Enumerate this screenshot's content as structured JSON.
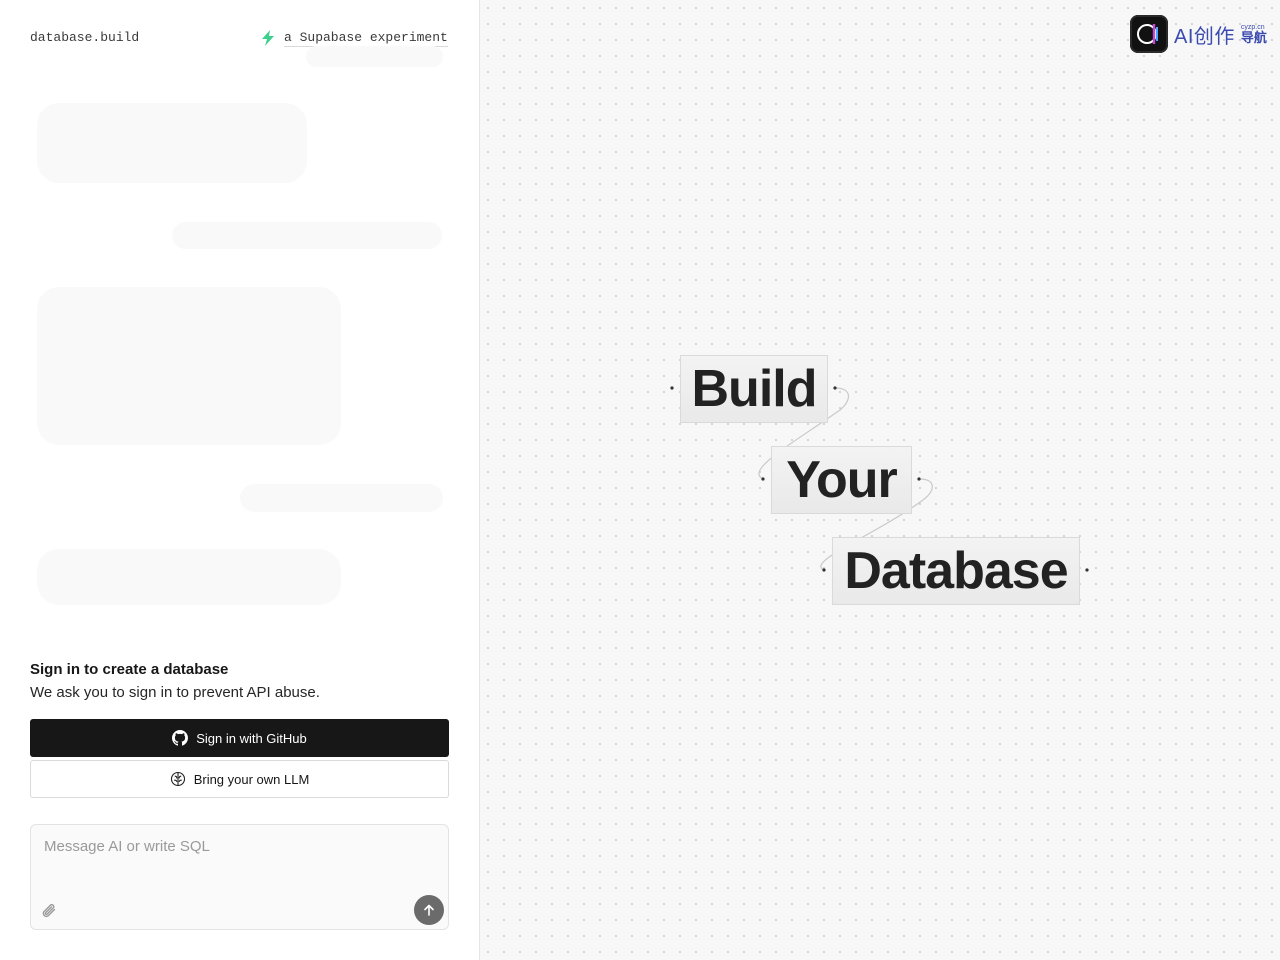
{
  "header": {
    "brand": "database.build",
    "experiment_text": "a Supabase experiment"
  },
  "signin": {
    "title": "Sign in to create a database",
    "description": "We ask you to sign in to prevent API abuse.",
    "github_button": "Sign in with GitHub",
    "llm_button": "Bring your own LLM"
  },
  "composer": {
    "placeholder": "Message AI or write SQL"
  },
  "canvas": {
    "words": [
      "Build",
      "Your",
      "Database"
    ]
  },
  "watermark": {
    "text": "AI创作",
    "subtext": "导航",
    "tiny": "cyzp.cn"
  },
  "colors": {
    "accent_green": "#3ecf8e",
    "primary_button": "#171717",
    "canvas_bg": "#f7f7f7",
    "watermark_blue": "#3b4bb0"
  },
  "icons": [
    "bolt-icon",
    "github-icon",
    "brain-icon",
    "paperclip-icon",
    "arrow-up-icon"
  ]
}
